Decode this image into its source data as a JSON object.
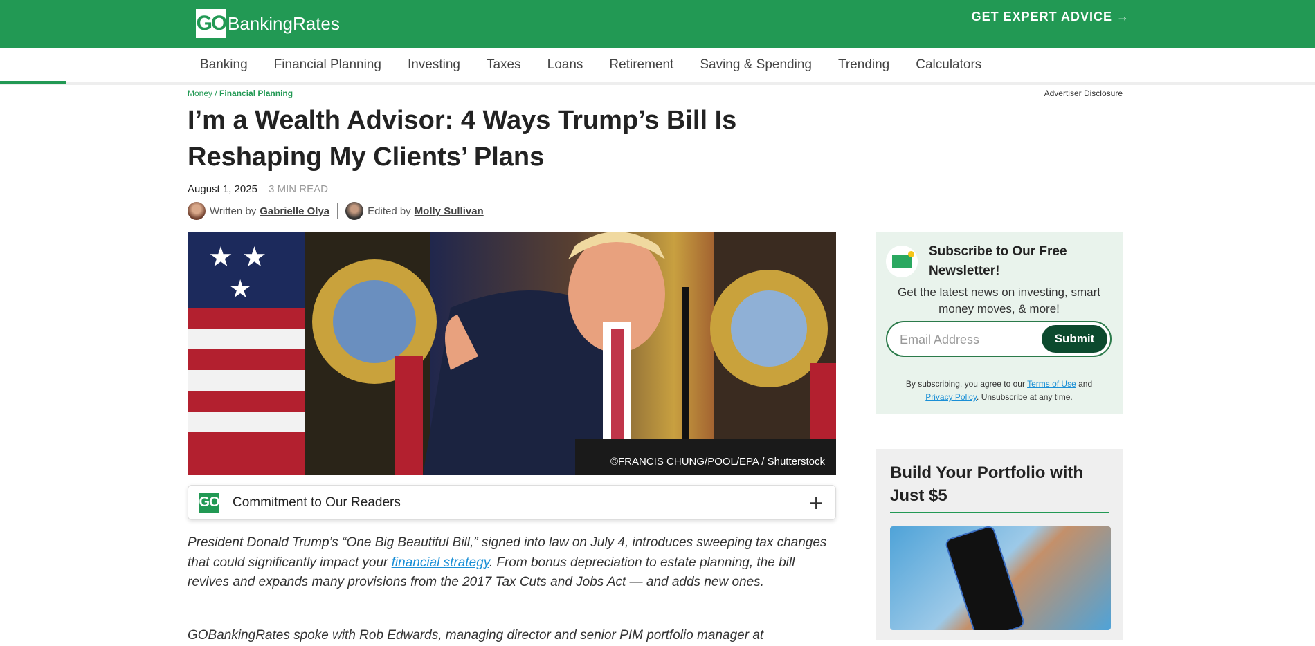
{
  "header": {
    "logo_mark": "GO",
    "logo_text": "BankingRates",
    "cta": "GET EXPERT ADVICE →"
  },
  "nav": {
    "items": [
      "Banking",
      "Financial Planning",
      "Investing",
      "Taxes",
      "Loans",
      "Retirement",
      "Saving & Spending",
      "Trending",
      "Calculators"
    ]
  },
  "reading_progress": 0.05,
  "breadcrumb": {
    "root": "Money",
    "separator": " / ",
    "current": "Financial Planning"
  },
  "advertiser_disclosure": "Advertiser Disclosure",
  "article": {
    "title": "I’m a Wealth Advisor: 4 Ways Trump’s Bill Is Reshaping My Clients’ Plans",
    "date": "August 1, 2025",
    "read_time": "3 MIN READ",
    "written_prefix": "Written by",
    "author": "Gabrielle Olya",
    "edited_prefix": "Edited by",
    "editor": "Molly Sullivan",
    "image_credit": "©FRANCIS CHUNG/POOL/EPA / Shutterstock",
    "commitment_label": "Commitment to Our Readers",
    "commitment_logo": "GO",
    "p1_before": "President Donald Trump’s “One Big Beautiful Bill,” signed into law on July 4, introduces sweeping tax changes that could significantly impact your ",
    "p1_link": "financial strategy",
    "p1_after": ". From bonus depreciation to estate planning, the bill revives and expands many provisions from the 2017 Tax Cuts and Jobs Act — and adds new ones.",
    "p2": "GOBankingRates spoke with Rob Edwards, managing director and senior PIM portfolio manager at"
  },
  "newsletter": {
    "title": "Subscribe to Our Free Newsletter!",
    "description": "Get the latest news on investing, smart money moves, & more!",
    "email_placeholder": "Email Address",
    "submit_label": "Submit",
    "legal_before": "By subscribing, you agree to our ",
    "terms_link": "Terms of Use",
    "legal_and": " and ",
    "privacy_link": "Privacy Policy",
    "legal_after": ". Unsubscribe at any time."
  },
  "promo": {
    "title": "Build Your Portfolio with Just $5"
  },
  "colors": {
    "brand_green": "#229954",
    "dark_green": "#0c4a2e",
    "link_blue": "#1a8fd6"
  }
}
